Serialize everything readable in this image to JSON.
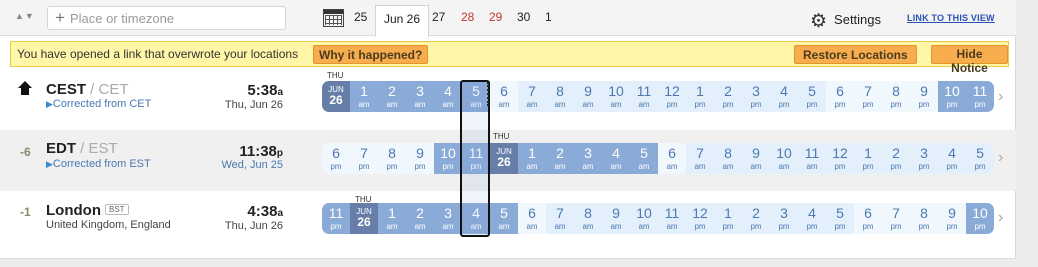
{
  "search": {
    "placeholder": "Place or timezone"
  },
  "date_tabs": [
    {
      "label": "25",
      "kind": "normal"
    },
    {
      "label": "Jun 26",
      "kind": "selected"
    },
    {
      "label": "27",
      "kind": "normal"
    },
    {
      "label": "28",
      "kind": "weekend"
    },
    {
      "label": "29",
      "kind": "weekend"
    },
    {
      "label": "30",
      "kind": "normal"
    },
    {
      "label": "1",
      "kind": "normal"
    }
  ],
  "header": {
    "settings_label": "Settings",
    "link_label": "LINK TO THIS VIEW"
  },
  "notice": {
    "message": "You have opened a link that overwrote your locations",
    "why_label": "Why it happened?",
    "restore_label": "Restore Locations",
    "hide_label": "Hide Notice"
  },
  "rows": [
    {
      "offset": "",
      "name": "CEST",
      "alt": " / CET",
      "badge": "",
      "sub": "Corrected from CET",
      "time": "5:38",
      "ampm": "a",
      "date": "Thu, Jun 26",
      "day_label": "THU",
      "cells": [
        [
          "date",
          "JUN",
          "26"
        ],
        [
          "night",
          "1",
          "am"
        ],
        [
          "night",
          "2",
          "am"
        ],
        [
          "night",
          "3",
          "am"
        ],
        [
          "night",
          "4",
          "am"
        ],
        [
          "night",
          "5",
          "am"
        ],
        [
          "mid",
          "6",
          "am"
        ],
        [
          "day",
          "7",
          "am"
        ],
        [
          "day",
          "8",
          "am"
        ],
        [
          "day",
          "9",
          "am"
        ],
        [
          "day",
          "10",
          "am"
        ],
        [
          "day",
          "11",
          "am"
        ],
        [
          "day",
          "12",
          "pm"
        ],
        [
          "day",
          "1",
          "pm"
        ],
        [
          "day",
          "2",
          "pm"
        ],
        [
          "day",
          "3",
          "pm"
        ],
        [
          "day",
          "4",
          "pm"
        ],
        [
          "day",
          "5",
          "pm"
        ],
        [
          "mid",
          "6",
          "pm"
        ],
        [
          "mid",
          "7",
          "pm"
        ],
        [
          "mid",
          "8",
          "pm"
        ],
        [
          "mid",
          "9",
          "pm"
        ],
        [
          "night",
          "10",
          "pm"
        ],
        [
          "night",
          "11",
          "pm"
        ]
      ]
    },
    {
      "offset": "-6",
      "name": "EDT",
      "alt": " / EST",
      "badge": "",
      "sub": "Corrected from EST",
      "time": "11:38",
      "ampm": "p",
      "date": "Wed, Jun 25",
      "day_label": "THU",
      "cells": [
        [
          "mid",
          "6",
          "pm"
        ],
        [
          "mid",
          "7",
          "pm"
        ],
        [
          "mid",
          "8",
          "pm"
        ],
        [
          "mid",
          "9",
          "pm"
        ],
        [
          "night",
          "10",
          "pm"
        ],
        [
          "night",
          "11",
          "pm"
        ],
        [
          "date",
          "JUN",
          "26"
        ],
        [
          "night",
          "1",
          "am"
        ],
        [
          "night",
          "2",
          "am"
        ],
        [
          "night",
          "3",
          "am"
        ],
        [
          "night",
          "4",
          "am"
        ],
        [
          "night",
          "5",
          "am"
        ],
        [
          "mid",
          "6",
          "am"
        ],
        [
          "day",
          "7",
          "am"
        ],
        [
          "day",
          "8",
          "am"
        ],
        [
          "day",
          "9",
          "am"
        ],
        [
          "day",
          "10",
          "am"
        ],
        [
          "day",
          "11",
          "am"
        ],
        [
          "day",
          "12",
          "pm"
        ],
        [
          "day",
          "1",
          "pm"
        ],
        [
          "day",
          "2",
          "pm"
        ],
        [
          "day",
          "3",
          "pm"
        ],
        [
          "day",
          "4",
          "pm"
        ],
        [
          "day",
          "5",
          "pm"
        ]
      ]
    },
    {
      "offset": "-1",
      "name": "London",
      "alt": "",
      "badge": "BST",
      "sub": "United Kingdom, England",
      "time": "4:38",
      "ampm": "a",
      "date": "Thu, Jun 26",
      "day_label": "THU",
      "cells": [
        [
          "night",
          "11",
          "pm"
        ],
        [
          "date",
          "JUN",
          "26"
        ],
        [
          "night",
          "1",
          "am"
        ],
        [
          "night",
          "2",
          "am"
        ],
        [
          "night",
          "3",
          "am"
        ],
        [
          "night",
          "4",
          "am"
        ],
        [
          "night",
          "5",
          "am"
        ],
        [
          "mid",
          "6",
          "am"
        ],
        [
          "day",
          "7",
          "am"
        ],
        [
          "day",
          "8",
          "am"
        ],
        [
          "day",
          "9",
          "am"
        ],
        [
          "day",
          "10",
          "am"
        ],
        [
          "day",
          "11",
          "am"
        ],
        [
          "day",
          "12",
          "pm"
        ],
        [
          "day",
          "1",
          "pm"
        ],
        [
          "day",
          "2",
          "pm"
        ],
        [
          "day",
          "3",
          "pm"
        ],
        [
          "day",
          "4",
          "pm"
        ],
        [
          "day",
          "5",
          "pm"
        ],
        [
          "mid",
          "6",
          "pm"
        ],
        [
          "mid",
          "7",
          "pm"
        ],
        [
          "mid",
          "8",
          "pm"
        ],
        [
          "mid",
          "9",
          "pm"
        ],
        [
          "night",
          "10",
          "pm"
        ]
      ]
    }
  ]
}
